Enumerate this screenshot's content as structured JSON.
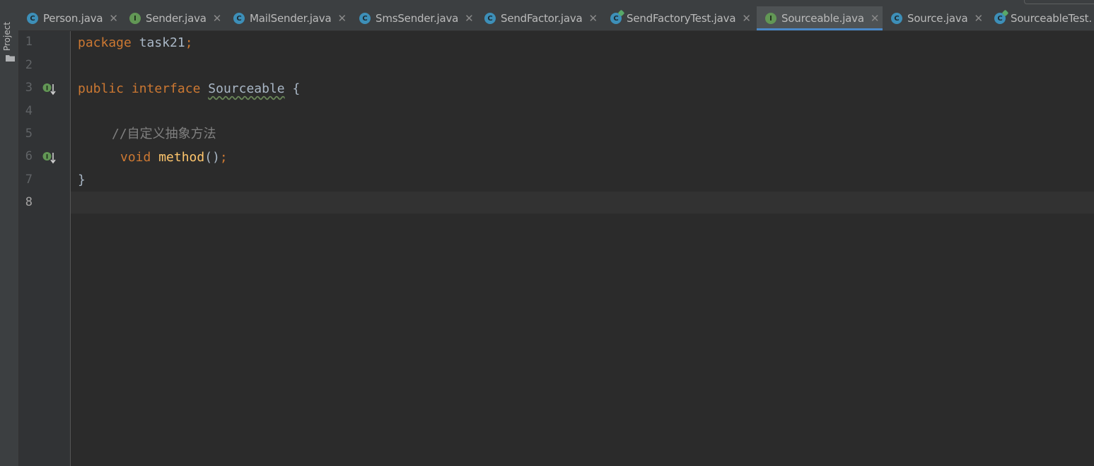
{
  "toolwindow": {
    "project_label": "Project",
    "folder_icon": "folder-icon"
  },
  "tabs": [
    {
      "label": "Person.java",
      "icon": "class-icon",
      "active": false
    },
    {
      "label": "Sender.java",
      "icon": "interface-icon",
      "active": false
    },
    {
      "label": "MailSender.java",
      "icon": "class-icon",
      "active": false
    },
    {
      "label": "SmsSender.java",
      "icon": "class-icon",
      "active": false
    },
    {
      "label": "SendFactor.java",
      "icon": "class-icon",
      "active": false
    },
    {
      "label": "SendFactoryTest.java",
      "icon": "test-class-icon",
      "active": false
    },
    {
      "label": "Sourceable.java",
      "icon": "interface-icon",
      "active": true
    },
    {
      "label": "Source.java",
      "icon": "class-icon",
      "active": false
    },
    {
      "label": "SourceableTest.",
      "icon": "test-class-icon",
      "active": false
    }
  ],
  "tab_close_glyph": "✕",
  "gutter": {
    "line_numbers": [
      "1",
      "2",
      "3",
      "4",
      "5",
      "6",
      "7",
      "8"
    ],
    "current_line": "8",
    "implemented_marker_lines": [
      "3",
      "6"
    ],
    "marker_icon": "implemented-interface-icon"
  },
  "code": {
    "line1": {
      "keyword": "package",
      "name": "task21",
      "semi": ";"
    },
    "line3": {
      "kw_public": "public",
      "kw_interface": "interface",
      "name": "Sourceable",
      "brace_open": "{"
    },
    "line5": {
      "comment": "//自定义抽象方法"
    },
    "line6": {
      "kw_void": "void",
      "method": "method",
      "parens": "()",
      "semi": ";"
    },
    "line7": {
      "brace_close": "}"
    }
  },
  "colors": {
    "keyword": "#cc7832",
    "text": "#a9b7c6",
    "method": "#ffc66d",
    "comment": "#808080",
    "class_icon": "#3d8fb8",
    "interface_icon": "#629755",
    "active_tab_underline": "#4a88c7"
  }
}
